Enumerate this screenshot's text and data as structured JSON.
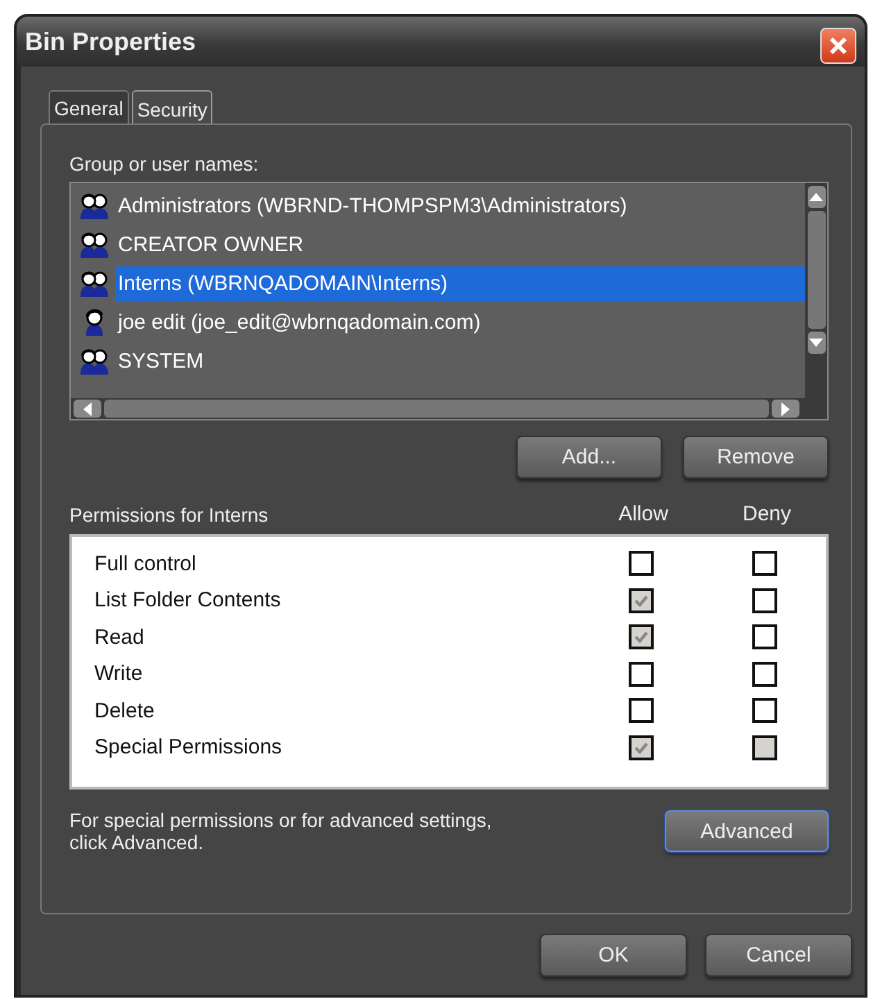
{
  "window": {
    "title": "Bin Properties"
  },
  "tabs": [
    {
      "label": "General",
      "selected": false
    },
    {
      "label": "Security",
      "selected": true
    }
  ],
  "names": {
    "label": "Group or user names:",
    "items": [
      {
        "name": "Administrators (WBRND-THOMPSPM3\\Administrators)",
        "kind": "group",
        "selected": false
      },
      {
        "name": "CREATOR OWNER",
        "kind": "group",
        "selected": false
      },
      {
        "name": "Interns (WBRNQADOMAIN\\Interns)",
        "kind": "group",
        "selected": true
      },
      {
        "name": "joe edit (joe_edit@wbrnqadomain.com)",
        "kind": "user",
        "selected": false
      },
      {
        "name": "SYSTEM",
        "kind": "group",
        "selected": false
      }
    ]
  },
  "name_buttons": [
    "Add...",
    "Remove"
  ],
  "permissions": {
    "label": "Permissions for Interns",
    "allow_heading": "Allow",
    "deny_heading": "Deny",
    "rows": [
      {
        "name": "Full control",
        "allow": {
          "checked": false,
          "disabled": false
        },
        "deny": {
          "checked": false,
          "disabled": false
        }
      },
      {
        "name": "List Folder Contents",
        "allow": {
          "checked": true,
          "disabled": true
        },
        "deny": {
          "checked": false,
          "disabled": false
        }
      },
      {
        "name": "Read",
        "allow": {
          "checked": true,
          "disabled": true
        },
        "deny": {
          "checked": false,
          "disabled": false
        }
      },
      {
        "name": "Write",
        "allow": {
          "checked": false,
          "disabled": false
        },
        "deny": {
          "checked": false,
          "disabled": false
        }
      },
      {
        "name": "Delete",
        "allow": {
          "checked": false,
          "disabled": false
        },
        "deny": {
          "checked": false,
          "disabled": false
        }
      },
      {
        "name": "Special Permissions",
        "allow": {
          "checked": true,
          "disabled": true
        },
        "deny": {
          "checked": false,
          "disabled": true
        }
      }
    ]
  },
  "advanced": {
    "note": "For special permissions or for advanced settings, click Advanced.",
    "button": "Advanced"
  },
  "buttons": [
    "OK",
    "Cancel"
  ]
}
